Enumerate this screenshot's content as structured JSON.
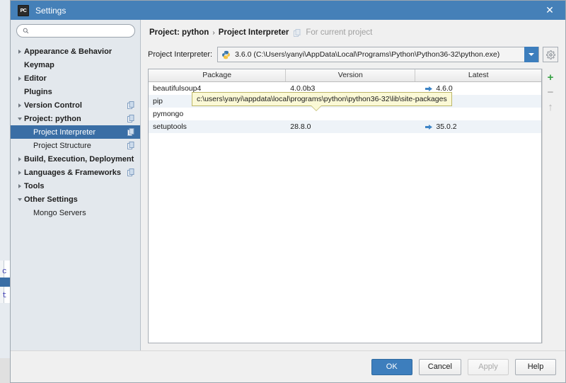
{
  "window": {
    "title": "Settings",
    "app_icon": "pycharm-icon",
    "close_label": "✕",
    "titlebar_color": "#4580b8"
  },
  "search": {
    "placeholder": "",
    "value": "",
    "icon": "search-icon"
  },
  "sidebar": {
    "items": [
      {
        "label": "Appearance & Behavior",
        "level": 0,
        "twisty": "collapsed",
        "selected": false,
        "copy_icon": false
      },
      {
        "label": "Keymap",
        "level": 0,
        "twisty": "none",
        "selected": false,
        "copy_icon": false
      },
      {
        "label": "Editor",
        "level": 0,
        "twisty": "collapsed",
        "selected": false,
        "copy_icon": false
      },
      {
        "label": "Plugins",
        "level": 0,
        "twisty": "none",
        "selected": false,
        "copy_icon": false
      },
      {
        "label": "Version Control",
        "level": 0,
        "twisty": "collapsed",
        "selected": false,
        "copy_icon": true
      },
      {
        "label": "Project: python",
        "level": 0,
        "twisty": "expanded",
        "selected": false,
        "copy_icon": true
      },
      {
        "label": "Project Interpreter",
        "level": 1,
        "twisty": "none",
        "selected": true,
        "copy_icon": true
      },
      {
        "label": "Project Structure",
        "level": 1,
        "twisty": "none",
        "selected": false,
        "copy_icon": true
      },
      {
        "label": "Build, Execution, Deployment",
        "level": 0,
        "twisty": "collapsed",
        "selected": false,
        "copy_icon": false
      },
      {
        "label": "Languages & Frameworks",
        "level": 0,
        "twisty": "collapsed",
        "selected": false,
        "copy_icon": true
      },
      {
        "label": "Tools",
        "level": 0,
        "twisty": "collapsed",
        "selected": false,
        "copy_icon": false
      },
      {
        "label": "Other Settings",
        "level": 0,
        "twisty": "expanded",
        "selected": false,
        "copy_icon": false
      },
      {
        "label": "Mongo Servers",
        "level": 1,
        "twisty": "none",
        "selected": false,
        "copy_icon": false
      }
    ]
  },
  "breadcrumb": {
    "project": "Project: python",
    "separator": "›",
    "page": "Project Interpreter",
    "scope_note": "For current project",
    "scope_icon": "copy-icon"
  },
  "interpreter": {
    "label": "Project Interpreter:",
    "icon": "python-icon",
    "value": "3.6.0 (C:\\Users\\yanyi\\AppData\\Local\\Programs\\Python\\Python36-32\\python.exe)",
    "dropdown_icon": "chevron-down-icon",
    "settings_icon": "gear-icon"
  },
  "packages": {
    "columns": [
      "Package",
      "Version",
      "Latest"
    ],
    "rows": [
      {
        "package": "beautifulsoup4",
        "version": "4.0.0b3",
        "latest": "4.6.0",
        "upgrade": true
      },
      {
        "package": "pip",
        "version": "",
        "latest": "",
        "upgrade": false
      },
      {
        "package": "pymongo",
        "version": "",
        "latest": "",
        "upgrade": false
      },
      {
        "package": "setuptools",
        "version": "28.8.0",
        "latest": "35.0.2",
        "upgrade": true
      }
    ],
    "tools": [
      {
        "name": "add-package-button",
        "glyph": "+",
        "enabled": true,
        "color": "#36a043"
      },
      {
        "name": "remove-package-button",
        "glyph": "−",
        "enabled": false,
        "color": "#b6b6b6"
      },
      {
        "name": "upgrade-package-button",
        "glyph": "↑",
        "enabled": false,
        "color": "#b6b6b6"
      }
    ]
  },
  "tooltip": {
    "text": "c:\\users\\yanyi\\appdata\\local\\programs\\python\\python36-32\\lib\\site-packages"
  },
  "footer": {
    "buttons": [
      {
        "label": "OK",
        "style": "primary",
        "enabled": true
      },
      {
        "label": "Cancel",
        "style": "default",
        "enabled": true
      },
      {
        "label": "Apply",
        "style": "disabled",
        "enabled": false
      },
      {
        "label": "Help",
        "style": "default",
        "enabled": true
      }
    ]
  },
  "background": {
    "lines": [
      "c",
      "t"
    ]
  }
}
